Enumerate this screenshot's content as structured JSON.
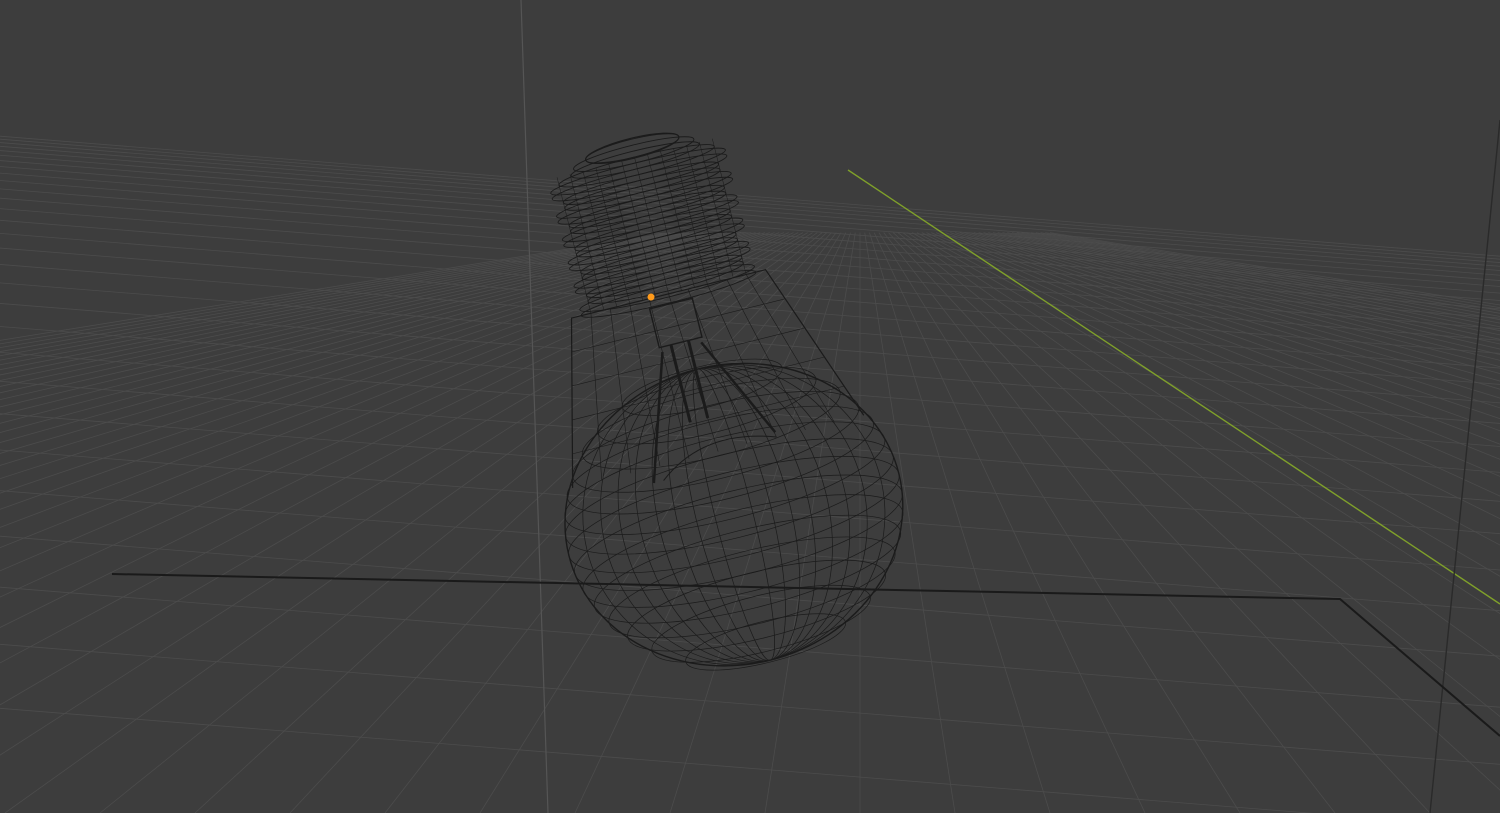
{
  "viewport": {
    "mode": "wireframe",
    "object": "light-bulb"
  },
  "colors": {
    "background": "#3d3d3d",
    "grid": "#4c4c4c",
    "grid_major": "#555555",
    "y_axis": "#7fa02a",
    "z_axis": "#2a2a2a",
    "wire": "#1b1b1b",
    "origin": "#ff9a1a",
    "boundary": "#1a1a1a"
  }
}
